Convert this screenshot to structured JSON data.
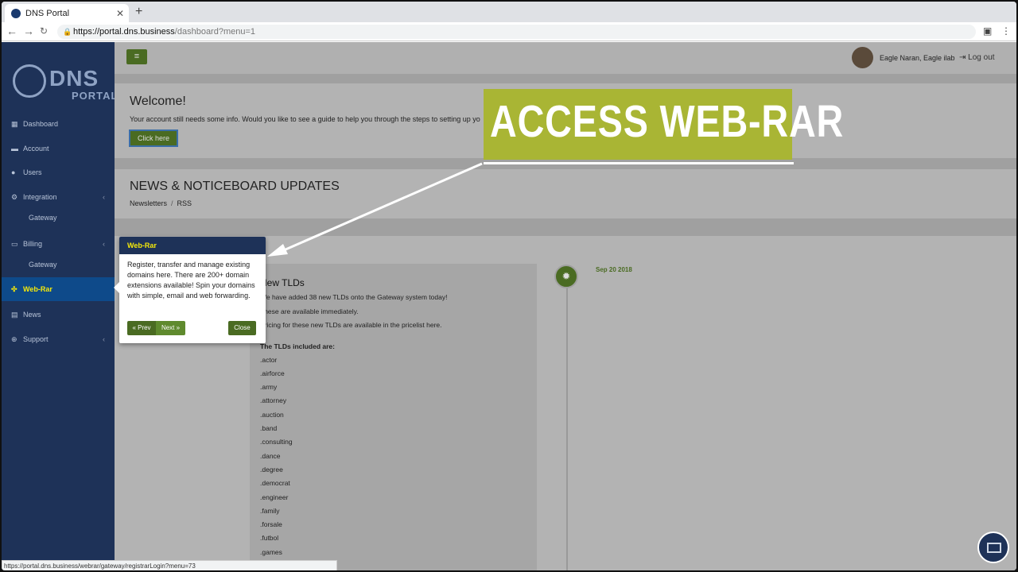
{
  "browser": {
    "tab_title": "DNS Portal",
    "tab_close": "✕",
    "new_tab": "+",
    "url_host": "https://portal.dns.business",
    "url_path": "/dashboard?menu=1",
    "status_url": "https://portal.dns.business/webrar/gateway/registrarLogin?menu=73"
  },
  "logo": {
    "dns": "DNS",
    "portal": "PORTAL"
  },
  "sidebar": {
    "items": [
      {
        "label": "Dashboard"
      },
      {
        "label": "Account"
      },
      {
        "label": "Users"
      },
      {
        "label": "Integration"
      },
      {
        "label": "Gateway"
      },
      {
        "label": "Billing"
      },
      {
        "label": "Gateway"
      },
      {
        "label": "Web-Rar"
      },
      {
        "label": "News"
      },
      {
        "label": "Support"
      }
    ]
  },
  "header": {
    "menu_icon": "≡",
    "user_name": "Eagle Naran, Eagle ilab",
    "logout_label": "Log out"
  },
  "welcome": {
    "title": "Welcome!",
    "text": "Your account still needs some info. Would you like to see a guide to help you through the steps to setting up yo",
    "button_label": "Click here"
  },
  "news_section": {
    "title": "NEWS & NOTICEBOARD UPDATES",
    "breadcrumb": [
      "Newsletters",
      "RSS"
    ]
  },
  "post": {
    "title": "New TLDs",
    "date": "Sep 20 2018",
    "lines": [
      "We have added 38 new TLDs onto the Gateway system today!",
      "These are available immediately.",
      "Pricing for these new TLDs are available in the pricelist here."
    ],
    "tld_header": "The TLDs included are:",
    "tlds": [
      ".actor",
      ".airforce",
      ".army",
      ".attorney",
      ".auction",
      ".band",
      ".consulting",
      ".dance",
      ".degree",
      ".democrat",
      ".engineer",
      ".family",
      ".forsale",
      ".futbol",
      ".games"
    ]
  },
  "popover": {
    "title": "Web-Rar",
    "body": "Register, transfer and manage existing domains here. There are 200+ domain extensions available! Spin your domains with simple, email and web forwarding.",
    "prev_label": "« Prev",
    "next_label": "Next »",
    "close_label": "Close"
  },
  "banner": {
    "text": "ACCESS WEB-RAR"
  },
  "colors": {
    "sidebar": "#1e3258",
    "accent_green": "#4a6b22",
    "banner": "#a9b534",
    "active_text": "#f5e90a"
  }
}
